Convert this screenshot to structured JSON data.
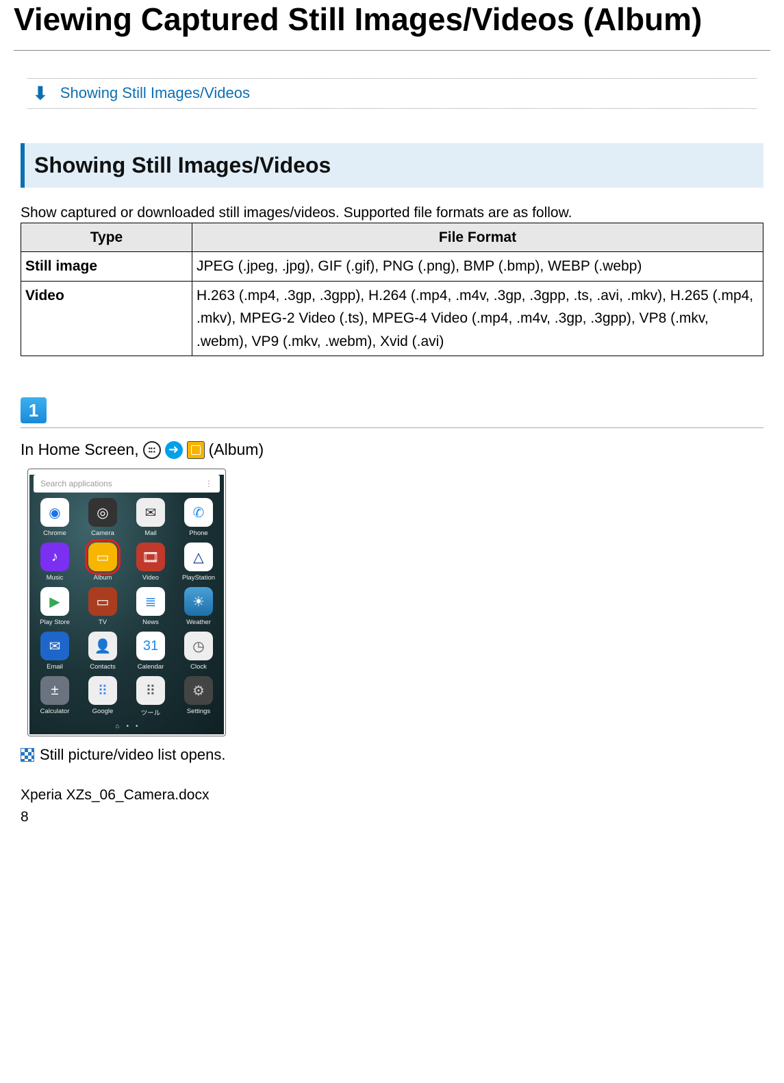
{
  "page": {
    "title": "Viewing Captured Still Images/Videos (Album)"
  },
  "toc": {
    "link1": "Showing Still Images/Videos"
  },
  "section": {
    "heading": "Showing Still Images/Videos",
    "intro": "Show captured or downloaded still images/videos. Supported file formats are as follow."
  },
  "table": {
    "head_type": "Type",
    "head_format": "File Format",
    "rows": [
      {
        "type": "Still image",
        "format": "JPEG (.jpeg, .jpg), GIF (.gif), PNG (.png), BMP (.bmp), WEBP (.webp)"
      },
      {
        "type": "Video",
        "format": "H.263 (.mp4, .3gp, .3gpp), H.264 (.mp4, .m4v, .3gp, .3gpp, .ts, .avi, .mkv), H.265 (.mp4, .mkv), MPEG-2 Video (.ts), MPEG-4 Video (.mp4, .m4v, .3gp, .3gpp), VP8 (.mkv, .webm), VP9 (.mkv, .webm), Xvid (.avi)"
      }
    ]
  },
  "step1": {
    "number": "1",
    "text_prefix": "In Home Screen,",
    "text_suffix": "(Album)"
  },
  "phone": {
    "search_placeholder": "Search applications",
    "menu_glyph": "⋮",
    "rows": [
      [
        {
          "label": "Chrome",
          "bg": "#fff",
          "glyph": "◉",
          "fg": "#1a73e8"
        },
        {
          "label": "Camera",
          "bg": "#333",
          "glyph": "◎",
          "fg": "#fff"
        },
        {
          "label": "Mail",
          "bg": "#eee",
          "glyph": "✉",
          "fg": "#333"
        },
        {
          "label": "Phone",
          "bg": "#fff",
          "glyph": "✆",
          "fg": "#1e88e5"
        }
      ],
      [
        {
          "label": "Music",
          "bg": "#7b2ff0",
          "glyph": "♪",
          "fg": "#fff"
        },
        {
          "label": "Album",
          "bg": "#f7b500",
          "glyph": "▭",
          "fg": "#fff",
          "highlight": true
        },
        {
          "label": "Video",
          "bg": "#c0392b",
          "glyph": "🎞",
          "fg": "#fff"
        },
        {
          "label": "PlayStation",
          "bg": "#fff",
          "glyph": "△",
          "fg": "#003087"
        }
      ],
      [
        {
          "label": "Play Store",
          "bg": "#fff",
          "glyph": "▶",
          "fg": "#34a853"
        },
        {
          "label": "TV",
          "bg": "#aa3d1f",
          "glyph": "▭",
          "fg": "#fff"
        },
        {
          "label": "News",
          "bg": "#fff",
          "glyph": "≣",
          "fg": "#1e88e5"
        },
        {
          "label": "Weather",
          "bg": "linear-gradient(#4aa0d8,#1e6fa8)",
          "glyph": "☀",
          "fg": "#fff"
        }
      ],
      [
        {
          "label": "Email",
          "bg": "#1e66c9",
          "glyph": "✉",
          "fg": "#fff"
        },
        {
          "label": "Contacts",
          "bg": "#eee",
          "glyph": "👤",
          "fg": "#555"
        },
        {
          "label": "Calendar",
          "bg": "#fff",
          "glyph": "31",
          "fg": "#1e88e5"
        },
        {
          "label": "Clock",
          "bg": "#eee",
          "glyph": "◷",
          "fg": "#555"
        }
      ],
      [
        {
          "label": "Calculator",
          "bg": "#6b7380",
          "glyph": "±",
          "fg": "#fff"
        },
        {
          "label": "Google",
          "bg": "#eee",
          "glyph": "⠿",
          "fg": "#4285f4"
        },
        {
          "label": "ツール",
          "bg": "#eee",
          "glyph": "⠿",
          "fg": "#555"
        },
        {
          "label": "Settings",
          "bg": "#444",
          "glyph": "⚙",
          "fg": "#ccc"
        }
      ]
    ]
  },
  "result": "Still picture/video list opens.",
  "footer": {
    "filename": "Xperia XZs_06_Camera.docx",
    "page_number": "8"
  }
}
